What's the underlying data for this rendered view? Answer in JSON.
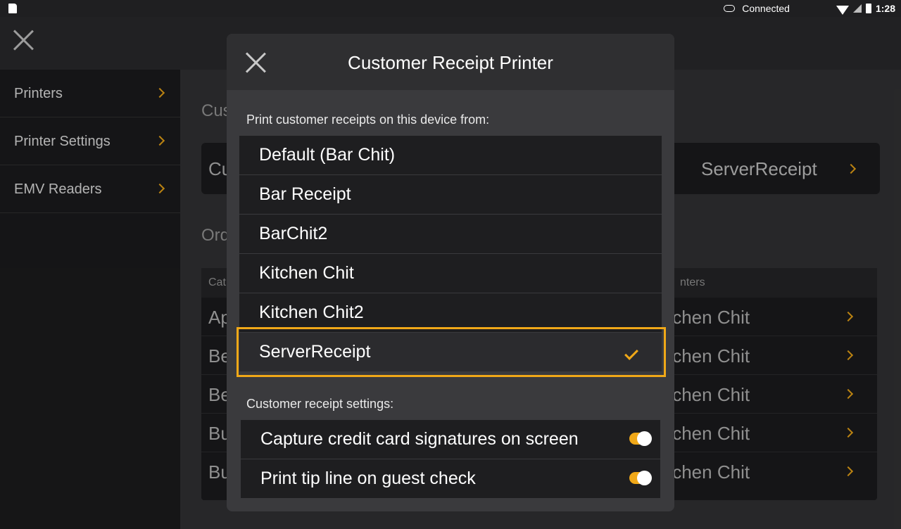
{
  "status_bar": {
    "connection_label": "Connected",
    "time": "1:28",
    "icons": [
      "sd-card-icon",
      "cloud-icon",
      "wifi-icon",
      "signal-icon",
      "battery-icon"
    ]
  },
  "sidebar": {
    "items": [
      {
        "label": "Printers"
      },
      {
        "label": "Printer Settings"
      },
      {
        "label": "EMV Readers"
      }
    ]
  },
  "background": {
    "section1_fragment": "Cus",
    "card_label_fragment": "Cu",
    "card_value": "ServerReceipt",
    "section2_fragment": "Ord",
    "table_header_left": "Cat",
    "table_header_right": "nters",
    "rows": [
      {
        "left": "Ap",
        "right": "tchen Chit"
      },
      {
        "left": "Be",
        "right": "tchen Chit"
      },
      {
        "left": "Be",
        "right": "tchen Chit"
      },
      {
        "left": "Bu",
        "right": "tchen Chit"
      },
      {
        "left": "Bu",
        "right": "tchen Chit"
      }
    ]
  },
  "modal": {
    "title": "Customer Receipt Printer",
    "print_from_label": "Print customer receipts on this device from:",
    "options": [
      {
        "label": "Default (Bar Chit)",
        "selected": false
      },
      {
        "label": "Bar Receipt",
        "selected": false
      },
      {
        "label": "BarChit2",
        "selected": false
      },
      {
        "label": "Kitchen Chit",
        "selected": false
      },
      {
        "label": "Kitchen Chit2",
        "selected": false
      },
      {
        "label": "ServerReceipt",
        "selected": true
      }
    ],
    "settings_label": "Customer receipt settings:",
    "settings": [
      {
        "label": "Capture credit card signatures on screen",
        "enabled": true
      },
      {
        "label": "Print tip line on guest check",
        "enabled": true
      }
    ]
  },
  "colors": {
    "accent": "#f0a818",
    "sidebar_bg": "#1c1c1e",
    "modal_bg": "#3a3a3d",
    "list_item_bg": "#1e1e20"
  }
}
